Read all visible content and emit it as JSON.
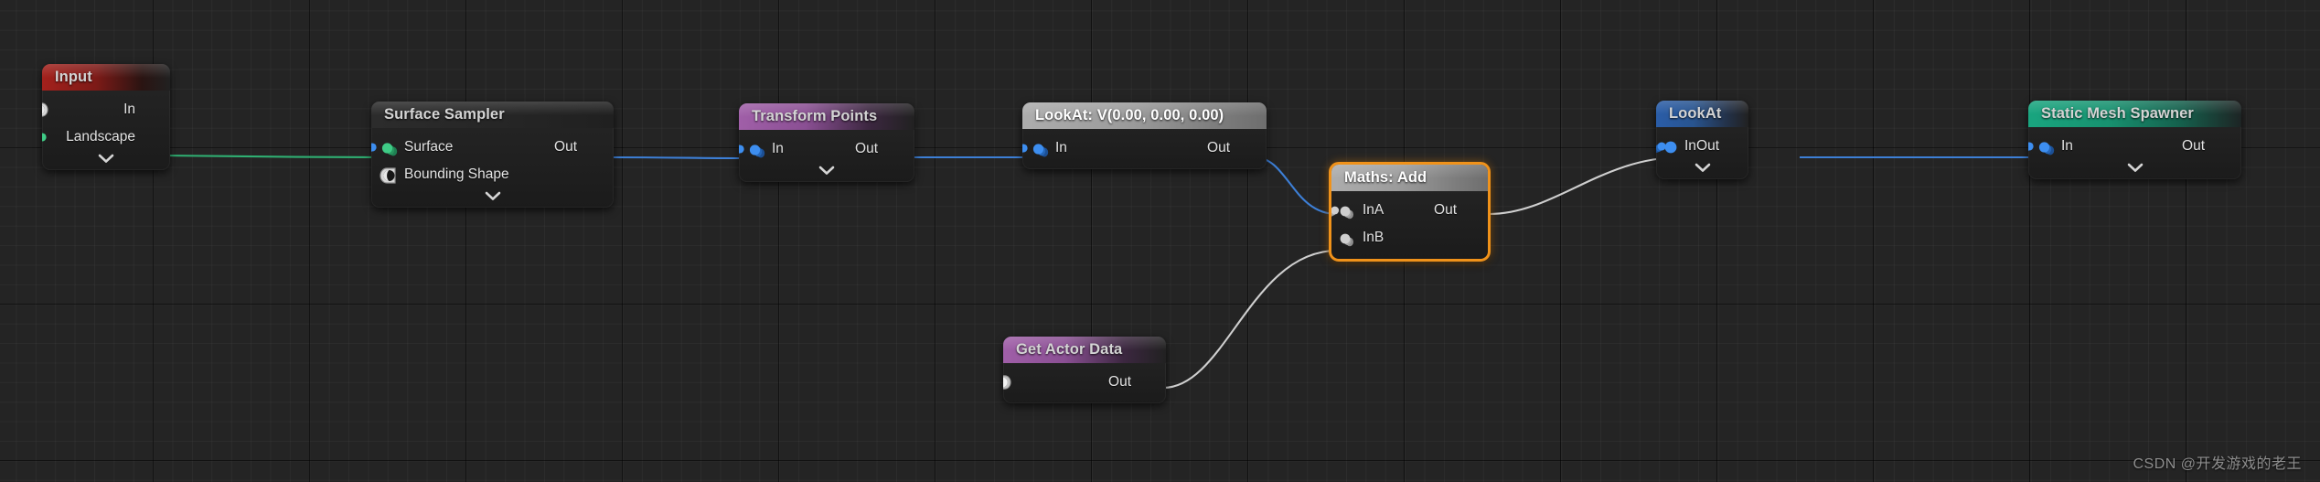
{
  "graph": {
    "watermark": "CSDN @开发游戏的老王",
    "colors": {
      "background": "#242424",
      "grid_minor": "#2b2b2b",
      "grid_major": "#151515",
      "selection": "#f0921a",
      "wire_green": "#2faf72",
      "wire_blue": "#3d7fd6",
      "wire_white": "#cfcfcf",
      "pin_green": "#2fbb76",
      "pin_blue": "#2f86ef",
      "pin_white": "#d8d8d8",
      "pin_gray": "#b9b9b9"
    }
  },
  "nodes": [
    {
      "id": "input",
      "title": "Input",
      "header_style": "red",
      "selected": false,
      "collapsible": true,
      "inputs": [],
      "outputs": [
        {
          "label": "In",
          "pin": "object-pin-icon",
          "color": "white"
        },
        {
          "label": "Landscape",
          "pin": "data-pin-icon",
          "color": "green"
        }
      ]
    },
    {
      "id": "surface-sampler",
      "title": "Surface Sampler",
      "header_style": "dark",
      "selected": false,
      "collapsible": true,
      "inputs": [
        {
          "label": "Surface",
          "pin": "data-pin-icon",
          "color": "green"
        },
        {
          "label": "Bounding Shape",
          "pin": "object-pin-icon",
          "color": "white"
        }
      ],
      "outputs": [
        {
          "label": "Out",
          "pin": "data-pin-icon",
          "color": "blue"
        }
      ]
    },
    {
      "id": "transform-points",
      "title": "Transform Points",
      "header_style": "purple",
      "selected": false,
      "collapsible": true,
      "inputs": [
        {
          "label": "In",
          "pin": "data-pin-icon",
          "color": "blue"
        }
      ],
      "outputs": [
        {
          "label": "Out",
          "pin": "data-pin-icon",
          "color": "blue"
        }
      ]
    },
    {
      "id": "lookat-vector",
      "title": "LookAt: V(0.00, 0.00, 0.00)",
      "header_style": "gray",
      "selected": false,
      "collapsible": false,
      "inputs": [
        {
          "label": "In",
          "pin": "data-pin-icon",
          "color": "blue"
        }
      ],
      "outputs": [
        {
          "label": "Out",
          "pin": "data-pin-icon",
          "color": "blue"
        }
      ]
    },
    {
      "id": "maths-add",
      "title": "Maths: Add",
      "header_style": "gray",
      "selected": true,
      "collapsible": false,
      "inputs": [
        {
          "label": "InA",
          "pin": "data-pin-icon",
          "color": "gray"
        },
        {
          "label": "InB",
          "pin": "data-pin-icon",
          "color": "gray"
        }
      ],
      "outputs": [
        {
          "label": "Out",
          "pin": "data-pin-icon",
          "color": "gray"
        }
      ]
    },
    {
      "id": "get-actor-data",
      "title": "Get Actor Data",
      "header_style": "purple",
      "selected": false,
      "collapsible": false,
      "inputs": [],
      "outputs": [
        {
          "label": "Out",
          "pin": "object-pin-icon",
          "color": "white"
        }
      ]
    },
    {
      "id": "lookat",
      "title": "LookAt",
      "header_style": "blue",
      "selected": false,
      "collapsible": true,
      "inputs": [
        {
          "label": "In",
          "pin": "circle-pin-icon",
          "color": "blue"
        }
      ],
      "outputs": [
        {
          "label": "Out",
          "pin": "data-pin-icon",
          "color": "blue"
        }
      ]
    },
    {
      "id": "static-mesh-spawner",
      "title": "Static Mesh Spawner",
      "header_style": "teal",
      "selected": false,
      "collapsible": true,
      "inputs": [
        {
          "label": "In",
          "pin": "data-pin-icon",
          "color": "blue"
        }
      ],
      "outputs": [
        {
          "label": "Out",
          "pin": "data-pin-icon",
          "color": "blue"
        }
      ]
    }
  ],
  "connections": [
    {
      "from": "input.Landscape",
      "to": "surface-sampler.Surface",
      "color": "green"
    },
    {
      "from": "surface-sampler.Out",
      "to": "transform-points.In",
      "color": "blue"
    },
    {
      "from": "transform-points.Out",
      "to": "lookat-vector.In",
      "color": "blue"
    },
    {
      "from": "lookat-vector.Out",
      "to": "maths-add.InA",
      "color": "blue"
    },
    {
      "from": "get-actor-data.Out",
      "to": "maths-add.InB",
      "color": "white"
    },
    {
      "from": "maths-add.Out",
      "to": "lookat.In",
      "color": "white"
    },
    {
      "from": "lookat.Out",
      "to": "static-mesh-spawner.In",
      "color": "blue"
    }
  ]
}
